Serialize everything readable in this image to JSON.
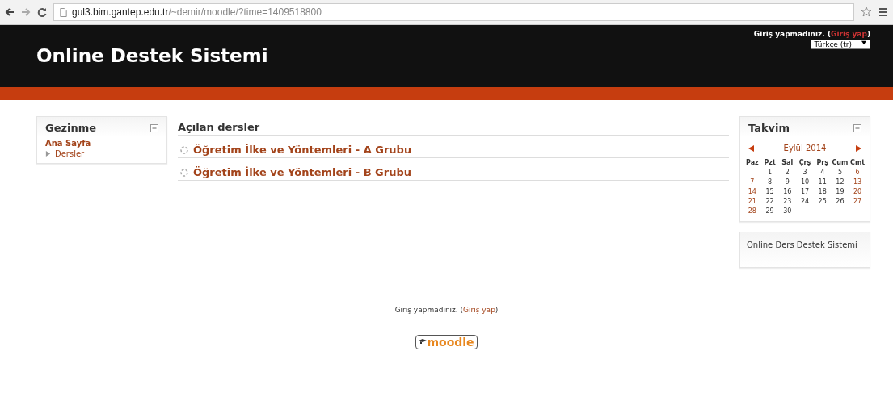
{
  "browser": {
    "url_host": "gul3.bim.gantep.edu.tr",
    "url_path": "/~demir/moodle/?time=1409518800"
  },
  "header": {
    "title": "Online Destek Sistemi",
    "login_text": "Giriş yapmadınız. (",
    "login_link": "Giriş yap",
    "login_close": ")",
    "language": "Türkçe (tr)"
  },
  "navigation": {
    "title": "Gezinme",
    "items": [
      {
        "label": "Ana Sayfa",
        "kind": "home"
      },
      {
        "label": "Dersler",
        "kind": "branch",
        "expanded": false
      }
    ]
  },
  "courses": {
    "title": "Açılan dersler",
    "items": [
      "Öğretim İlke ve Yöntemleri - A Grubu",
      "Öğretim İlke ve Yöntemleri - B Grubu"
    ]
  },
  "calendar": {
    "title": "Takvim",
    "month": "Eylül 2014",
    "weekdays": [
      "Paz",
      "Pzt",
      "Sal",
      "Çrş",
      "Prş",
      "Cum",
      "Cmt"
    ],
    "weeks": [
      [
        "1",
        "2",
        "3",
        "4",
        "5",
        "6"
      ],
      [
        "7",
        "8",
        "9",
        "10",
        "11",
        "12",
        "13"
      ],
      [
        "14",
        "15",
        "16",
        "17",
        "18",
        "19",
        "20"
      ],
      [
        "21",
        "22",
        "23",
        "24",
        "25",
        "26",
        "27"
      ],
      [
        "28",
        "29",
        "30"
      ]
    ]
  },
  "info_block": {
    "text": "Online Ders Destek Sistemi"
  },
  "footer": {
    "login_text": "Giriş yapmadınız. (",
    "login_link": "Giriş yap",
    "login_close": ")",
    "logo": "moodle"
  }
}
